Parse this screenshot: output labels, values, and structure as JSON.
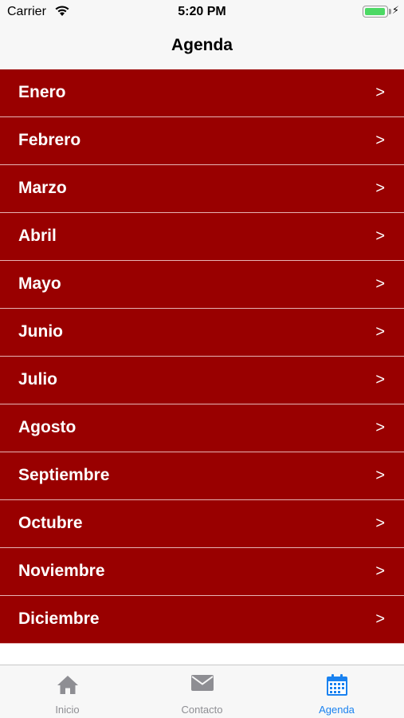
{
  "status_bar": {
    "carrier": "Carrier",
    "time": "5:20 PM",
    "battery_level": 1.0
  },
  "nav": {
    "title": "Agenda"
  },
  "months": [
    {
      "label": "Enero",
      "chevron": ">"
    },
    {
      "label": "Febrero",
      "chevron": ">"
    },
    {
      "label": "Marzo",
      "chevron": ">"
    },
    {
      "label": "Abril",
      "chevron": ">"
    },
    {
      "label": "Mayo",
      "chevron": ">"
    },
    {
      "label": "Junio",
      "chevron": ">"
    },
    {
      "label": "Julio",
      "chevron": ">"
    },
    {
      "label": "Agosto",
      "chevron": ">"
    },
    {
      "label": "Septiembre",
      "chevron": ">"
    },
    {
      "label": "Octubre",
      "chevron": ">"
    },
    {
      "label": "Noviembre",
      "chevron": ">"
    },
    {
      "label": "Diciembre",
      "chevron": ">"
    }
  ],
  "tab_bar": {
    "tabs": [
      {
        "label": "Inicio",
        "icon": "home-icon",
        "active": false
      },
      {
        "label": "Contacto",
        "icon": "mail-icon",
        "active": false
      },
      {
        "label": "Agenda",
        "icon": "calendar-icon",
        "active": true
      }
    ]
  },
  "colors": {
    "row_background": "#990000",
    "row_divider": "#e6b3b3",
    "tab_active": "#1a82f0",
    "tab_inactive": "#8e8e93",
    "battery": "#4cd964"
  }
}
